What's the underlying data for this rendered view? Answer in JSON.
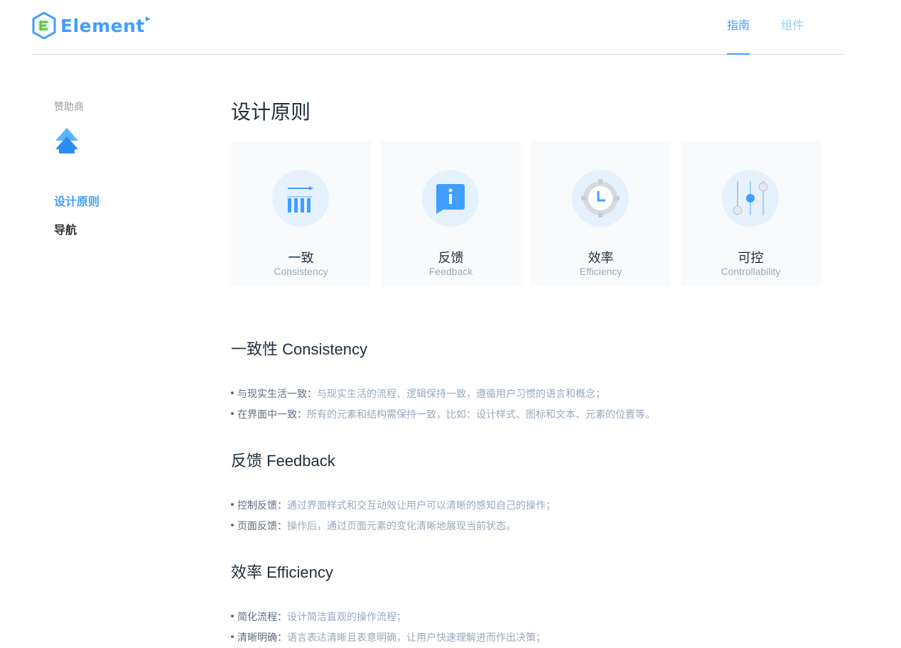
{
  "header": {
    "brand": "Element",
    "nav": [
      {
        "label": "指南",
        "active": true
      },
      {
        "label": "组件",
        "active": false
      }
    ]
  },
  "sidebar": {
    "sponsor_label": "赞助商",
    "links": [
      {
        "label": "设计原则",
        "active": true
      },
      {
        "label": "导航",
        "active": false
      }
    ]
  },
  "main": {
    "title": "设计原则",
    "cards": [
      {
        "title": "一致",
        "subtitle": "Consistency",
        "icon": "consistency-icon"
      },
      {
        "title": "反馈",
        "subtitle": "Feedback",
        "icon": "feedback-icon"
      },
      {
        "title": "效率",
        "subtitle": "Efficiency",
        "icon": "efficiency-icon"
      },
      {
        "title": "可控",
        "subtitle": "Controllability",
        "icon": "controllability-icon"
      }
    ],
    "sections": [
      {
        "heading": "一致性 Consistency",
        "items": [
          {
            "term": "与现实生活一致：",
            "desc": "与现实生活的流程、逻辑保持一致，遵循用户习惯的语言和概念；"
          },
          {
            "term": "在界面中一致：",
            "desc": "所有的元素和结构需保持一致，比如：设计样式、图标和文本、元素的位置等。"
          }
        ]
      },
      {
        "heading": "反馈 Feedback",
        "items": [
          {
            "term": "控制反馈：",
            "desc": "通过界面样式和交互动效让用户可以清晰的感知自己的操作；"
          },
          {
            "term": "页面反馈：",
            "desc": "操作后，通过页面元素的变化清晰地展现当前状态。"
          }
        ]
      },
      {
        "heading": "效率 Efficiency",
        "items": [
          {
            "term": "简化流程：",
            "desc": "设计简洁直观的操作流程；"
          },
          {
            "term": "清晰明确：",
            "desc": "语言表达清晰且表意明确，让用户快速理解进而作出决策；"
          }
        ]
      }
    ]
  },
  "colors": {
    "accent": "#409eff",
    "text_primary": "#1f2f3d",
    "text_secondary": "#99a9bf",
    "card_bg": "#f9fafc"
  }
}
